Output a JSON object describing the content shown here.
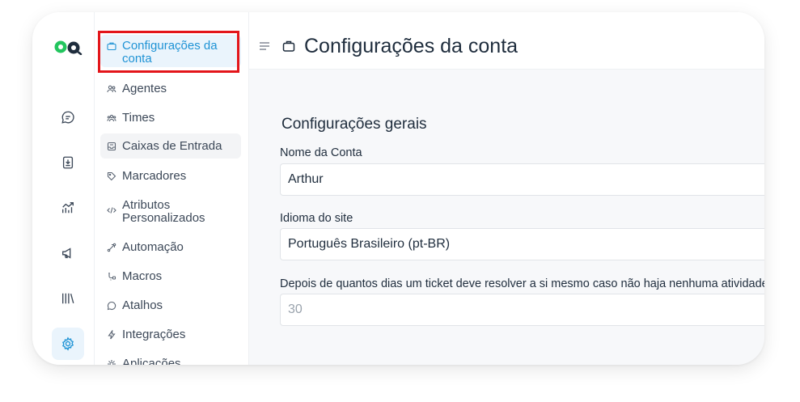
{
  "sidebar": {
    "items": [
      {
        "label": "Configurações da conta",
        "icon": "briefcase-icon"
      },
      {
        "label": "Agentes",
        "icon": "people-icon"
      },
      {
        "label": "Times",
        "icon": "team-icon"
      },
      {
        "label": "Caixas de Entrada",
        "icon": "inbox-icon"
      },
      {
        "label": "Marcadores",
        "icon": "tag-icon"
      },
      {
        "label": "Atributos Personalizados",
        "icon": "code-icon"
      },
      {
        "label": "Automação",
        "icon": "automation-icon"
      },
      {
        "label": "Macros",
        "icon": "macro-icon"
      },
      {
        "label": "Atalhos",
        "icon": "chat-icon"
      },
      {
        "label": "Integrações",
        "icon": "flash-icon"
      },
      {
        "label": "Aplicações",
        "icon": "apps-icon"
      }
    ]
  },
  "rail": {
    "icons": [
      "chat-bubble-icon",
      "contacts-icon",
      "reports-icon",
      "megaphone-icon",
      "library-icon",
      "settings-gear-icon"
    ]
  },
  "header": {
    "title": "Configurações da conta"
  },
  "general": {
    "section_title": "Configurações gerais",
    "account_name_label": "Nome da Conta",
    "account_name_value": "Arthur",
    "language_label": "Idioma do site",
    "language_value": "Português Brasileiro (pt-BR)",
    "auto_resolve_label": "Depois de quantos dias um ticket deve resolver a si mesmo caso não haja nenhuma atividade",
    "auto_resolve_placeholder": "30"
  },
  "colors": {
    "accent": "#1f93d5",
    "highlight": "#e3151a",
    "logo_green": "#23c55e"
  }
}
